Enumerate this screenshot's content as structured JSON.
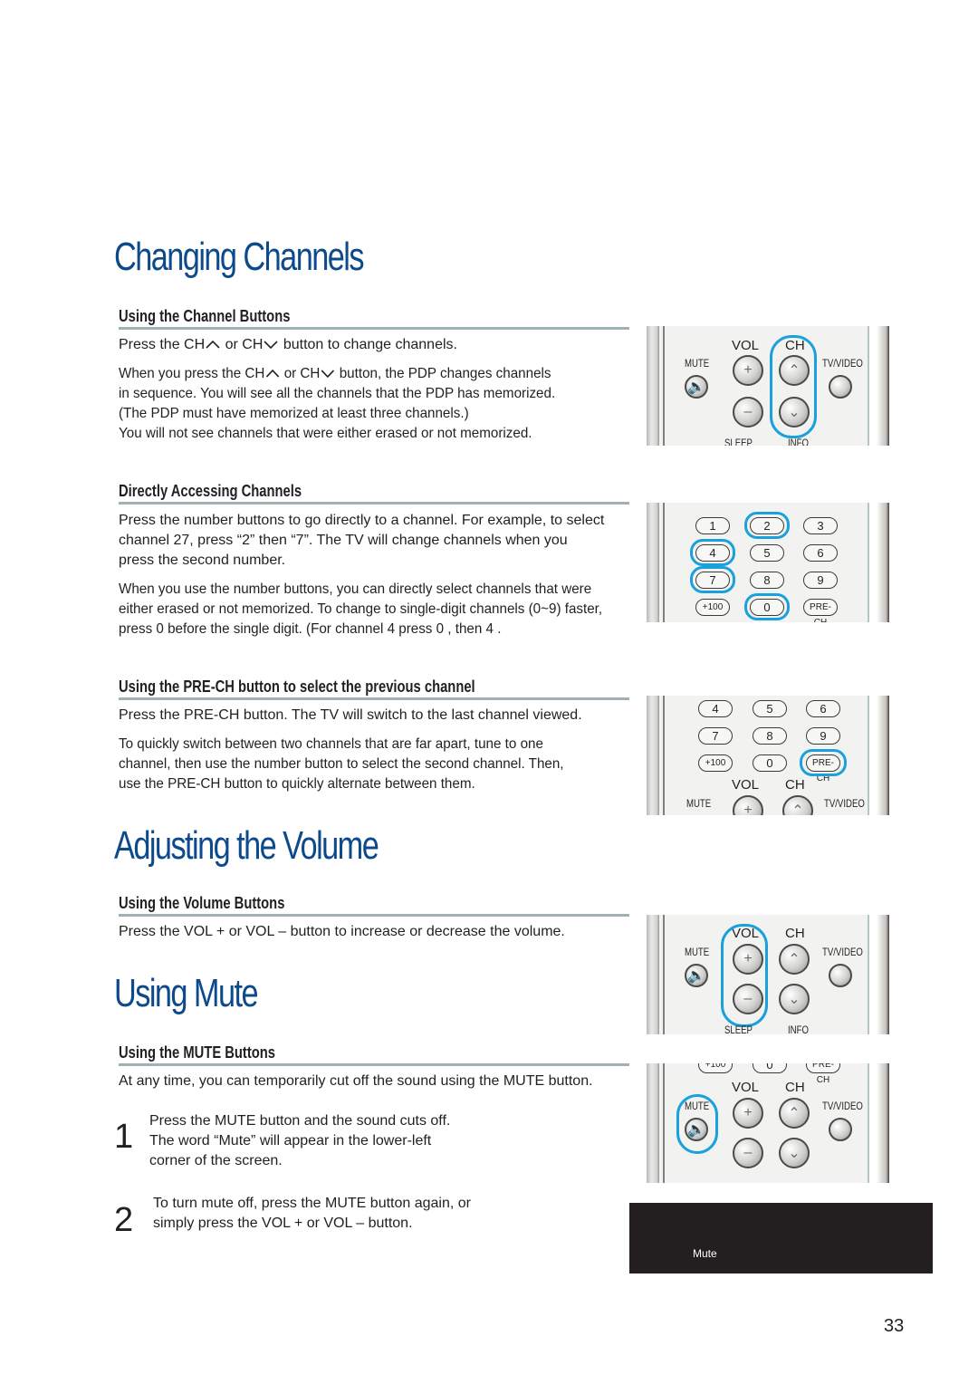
{
  "page": {
    "number": "33",
    "accent_color": "#0d4a8c",
    "highlight_color": "#1aa0dc"
  },
  "sections": {
    "changing_channels": {
      "title": "Changing Channels",
      "channel_buttons": {
        "heading": "Using the Channel Buttons",
        "line1_a": "Press the CH",
        "line1_b": " or CH",
        "line1_c": " button to change channels.",
        "para2_a": "When you press the CH",
        "para2_b": "  or CH",
        "para2_c": "  button, the PDP changes channels",
        "para2_l2": "in sequence. You will see all the channels that the PDP has memorized.",
        "para2_l3": "(The PDP must have memorized at least three channels.)",
        "para2_l4": "You will not see channels that were either erased or not memorized."
      },
      "direct_access": {
        "heading": "Directly Accessing Channels",
        "p1_l1": "Press the number buttons to go directly to a channel. For example, to select",
        "p1_l2": "channel 27, press “2” then “7”. The TV will change channels when you",
        "p1_l3": "press the second number.",
        "p2_l1": "When you use the number buttons, you can directly select channels that were",
        "p2_l2": "either erased or not memorized. To change to single-digit channels (0~9) faster,",
        "p2_l3": "press  0  before the single digit. (For channel  4  press  0 , then  4 ."
      },
      "prech": {
        "heading": "Using the PRE-CH button to select the previous channel",
        "p1": "Press the PRE-CH button. The TV will switch to the last channel viewed.",
        "p2_l1": "To quickly switch between two channels that are far apart, tune to one",
        "p2_l2": "channel, then use the number button to select the second channel. Then,",
        "p2_l3": "use the PRE-CH button to quickly alternate between them."
      }
    },
    "volume": {
      "title": "Adjusting the Volume",
      "heading": "Using the Volume Buttons",
      "p1": "Press the VOL + or VOL – button to increase or decrease the volume."
    },
    "mute": {
      "title": "Using Mute",
      "heading": "Using the MUTE Buttons",
      "p1": "At any time, you can temporarily cut off the sound using the MUTE button.",
      "steps": [
        {
          "num": "1",
          "l1": "Press the MUTE button and the sound cuts off.",
          "l2": "The word “Mute” will appear in the lower-left",
          "l3": "corner of the screen."
        },
        {
          "num": "2",
          "l1": "To turn mute off, press the MUTE button again, or",
          "l2": "simply press the VOL + or VOL – button."
        }
      ],
      "osd_text": "Mute"
    }
  },
  "remote": {
    "vol": "VOL",
    "ch": "CH",
    "mute": "MUTE",
    "tvvideo": "TV/VIDEO",
    "sleep": "SLEEP",
    "info": "INFO",
    "keys": [
      "1",
      "2",
      "3",
      "4",
      "5",
      "6",
      "7",
      "8",
      "9",
      "+100",
      "0",
      "PRE-CH"
    ],
    "icons": {
      "mute": "speaker-mute-icon",
      "vol_up": "plus-icon",
      "vol_down": "minus-icon",
      "ch_up": "chevron-up-icon",
      "ch_down": "chevron-down-icon"
    }
  }
}
